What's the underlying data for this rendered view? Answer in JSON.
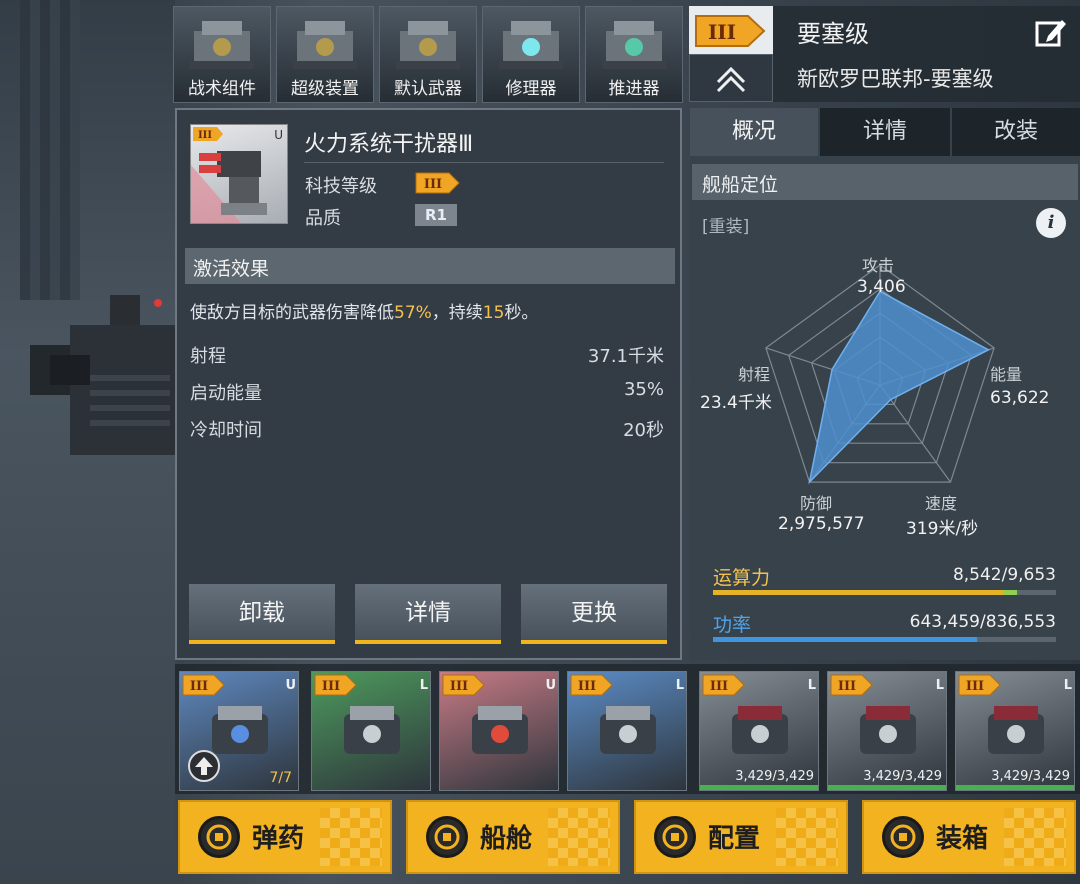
{
  "categories": [
    {
      "label": "战术组件",
      "icon": "tactical-component-icon"
    },
    {
      "label": "超级装置",
      "icon": "super-device-icon"
    },
    {
      "label": "默认武器",
      "icon": "default-weapon-icon"
    },
    {
      "label": "修理器",
      "icon": "repairer-icon"
    },
    {
      "label": "推进器",
      "icon": "thruster-icon"
    }
  ],
  "ship": {
    "tier_badge": "III",
    "class_name": "要塞级",
    "class_full": "新欧罗巴联邦-要塞级"
  },
  "item": {
    "name": "火力系统干扰器Ⅲ",
    "slot_type": "U",
    "tech_level_label": "科技等级",
    "tech_level": "III",
    "quality_label": "品质",
    "quality": "R1",
    "effect_header": "激活效果",
    "effect_prefix": "使敌方目标的武器伤害降低",
    "effect_pct": "57%",
    "effect_mid": "，持续",
    "effect_duration": "15",
    "effect_suffix": "秒。",
    "stats": [
      {
        "label": "射程",
        "value": "37.1千米"
      },
      {
        "label": "启动能量",
        "value": "35%"
      },
      {
        "label": "冷却时间",
        "value": "20秒"
      }
    ],
    "buttons": {
      "unload": "卸载",
      "detail": "详情",
      "replace": "更换"
    }
  },
  "right_tabs": {
    "overview": "概况",
    "detail": "详情",
    "modify": "改装"
  },
  "positioning": {
    "header": "舰船定位",
    "tag": "[重装]",
    "info_icon": "i"
  },
  "radar": {
    "attack": {
      "label": "攻击",
      "value": "3,406"
    },
    "energy": {
      "label": "能量",
      "value": "63,622"
    },
    "speed": {
      "label": "速度",
      "value": "319米/秒"
    },
    "defense": {
      "label": "防御",
      "value": "2,975,577"
    },
    "range": {
      "label": "射程",
      "value": "23.4千米"
    },
    "levels": {
      "attack": 0.78,
      "energy": 0.95,
      "speed": 0.15,
      "defense": 1.0,
      "range": 0.42
    }
  },
  "compute": {
    "label": "运算力",
    "value": "8,542/9,653",
    "fraction": 0.885
  },
  "power": {
    "label": "功率",
    "value": "643,459/836,553",
    "fraction": 0.769
  },
  "slots": [
    {
      "tier": "III",
      "side": "U",
      "count": "7/7",
      "bg": "#5e88bf",
      "icon": "repair-drone-icon"
    },
    {
      "tier": "III",
      "side": "L",
      "bg": "#4d9a5d",
      "icon": "device-box-icon"
    },
    {
      "tier": "III",
      "side": "U",
      "bg": "#c77b86",
      "icon": "jammer-turret-icon"
    },
    {
      "tier": "III",
      "side": "L",
      "bg": "#5b8cc6",
      "icon": "armor-module-icon"
    },
    {
      "tier": "III",
      "side": "L",
      "hp": "3,429/3,429",
      "bg": "#858d95",
      "icon": "missile-launcher-icon"
    },
    {
      "tier": "III",
      "side": "L",
      "hp": "3,429/3,429",
      "bg": "#858d95",
      "icon": "missile-launcher-icon"
    },
    {
      "tier": "III",
      "side": "L",
      "hp": "3,429/3,429",
      "bg": "#858d95",
      "icon": "missile-launcher-icon"
    }
  ],
  "bottom": [
    {
      "label": "弹药",
      "icon": "ammo-icon"
    },
    {
      "label": "船舱",
      "icon": "cabin-icon"
    },
    {
      "label": "配置",
      "icon": "config-icon"
    },
    {
      "label": "装箱",
      "icon": "crate-icon"
    }
  ],
  "colors": {
    "accent": "#f3b321",
    "highlight": "#f3c24c",
    "power": "#3e95e0"
  }
}
